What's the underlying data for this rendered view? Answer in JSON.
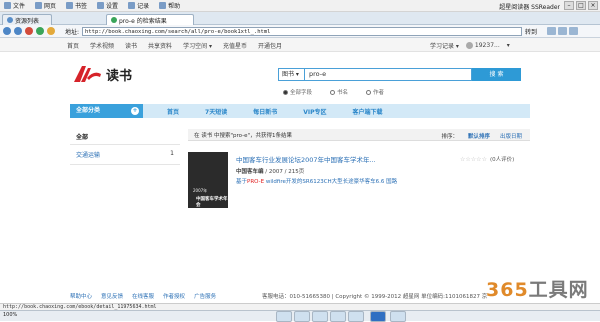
{
  "menubar": {
    "items": [
      "文件",
      "网页",
      "书签",
      "设置",
      "记录",
      "帮助"
    ],
    "app_title": "超星阅读器 SSReader"
  },
  "tabs": [
    {
      "label": "资源列表"
    },
    {
      "label": "pro-e 的检索结果"
    }
  ],
  "addressbar": {
    "label": "地址:",
    "url": "http://book.chaoxing.com/search/all/pro-e/book1xtl_.html",
    "go": "转到"
  },
  "topnav": {
    "links": [
      "首页",
      "学术视频",
      "读书",
      "共享资料",
      "学习空间 ▾",
      "充值星币",
      "开通包月"
    ],
    "right": [
      "学习记录 ▾",
      "19237...",
      "▾"
    ]
  },
  "logo": {
    "text": "读书"
  },
  "search": {
    "category": "图书 ▾",
    "query": "pro-e",
    "button": "搜 索",
    "radios": [
      "全部字段",
      "书名",
      "作者"
    ]
  },
  "catbar": {
    "all_label": "全部分类",
    "items": [
      "首页",
      "7天短读",
      "每日新书",
      "VIP专区",
      "客户端下载"
    ]
  },
  "sidebar": {
    "heading": "全部",
    "rows": [
      {
        "label": "交通运输",
        "count": "1"
      }
    ]
  },
  "results_header": {
    "summary": "在 读书 中搜索\"pro-e\"，共获得1条结果",
    "sort_label": "排序：",
    "sort_default": "默认排序",
    "sort_date": "出版日期"
  },
  "result": {
    "title": "中国客车行业发展论坛2007年中国客车学术年...",
    "meta_author": "中国客车编",
    "meta_year": "/ 2007 / 215页",
    "desc_pre": "基于",
    "desc_highlight": "PRO-E",
    "desc_post": " wildfire开发的SR6123CH大型长途豪华客车6.6 国路",
    "rating_count": "(0人评价)",
    "cover_line1": "2007年",
    "cover_line2": "中国客车学术年会"
  },
  "footer": {
    "links": [
      "帮助中心",
      "意见反馈",
      "在线客服",
      "作者授权",
      "广告服务"
    ],
    "copyright": "客服电话：010-51665380 | Copyright © 1999-2012 超星网 单位编码:1101061827 京"
  },
  "statusbar": {
    "text": "http://book.chaoxing.com/ebook/detail_11975634.html"
  },
  "taskbar": {
    "zoom": "100%"
  },
  "watermark": {
    "number": "365",
    "text": "工具网"
  }
}
